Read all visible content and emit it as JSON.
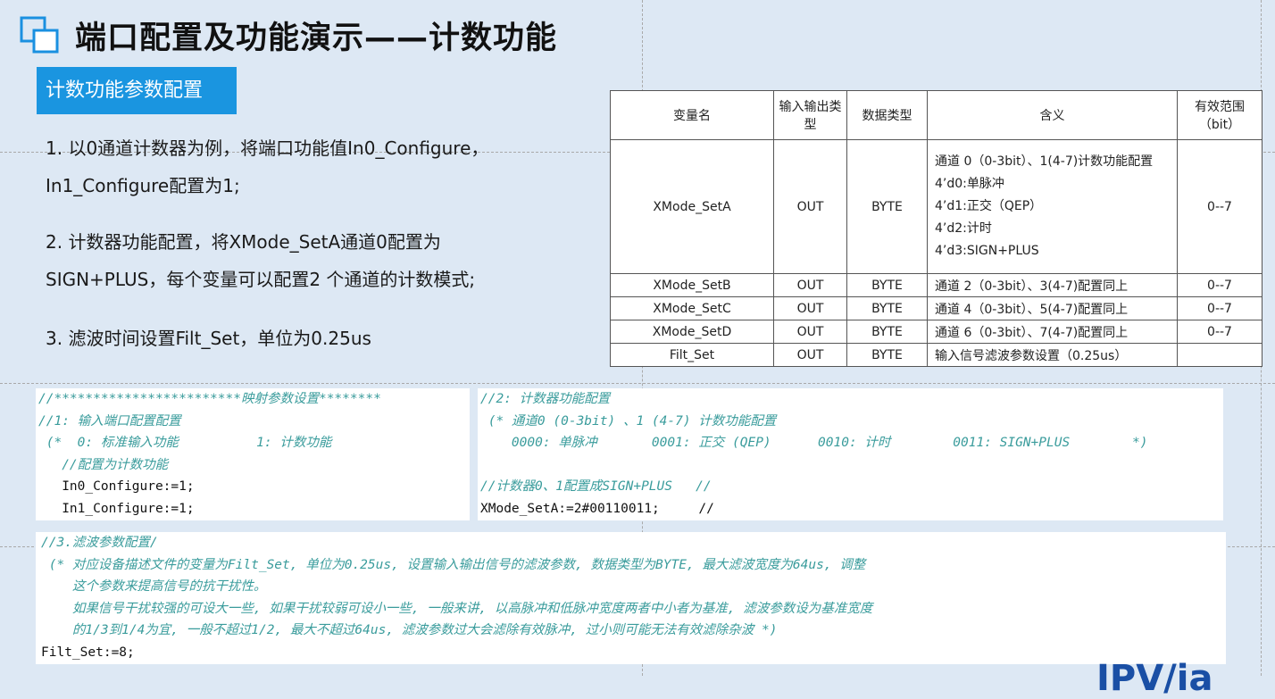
{
  "title": "端口配置及功能演示——计数功能",
  "section_badge": "计数功能参数配置",
  "paragraphs": [
    {
      "line1": "1. 以0通道计数器为例，将端口功能值In0_Configure，",
      "line2": "In1_Configure配置为1;"
    },
    {
      "line1": "2. 计数器功能配置，将XMode_SetA通道0配置为",
      "line2": "SIGN+PLUS，每个变量可以配置2 个通道的计数模式;"
    },
    {
      "line1": "3. 滤波时间设置Filt_Set，单位为0.25us"
    }
  ],
  "table": {
    "headers": [
      "变量名",
      "输入输出类型",
      "数据类型",
      "含义",
      "有效范围（bit）"
    ],
    "rows": [
      {
        "name": "XMode_SetA",
        "io": "OUT",
        "type": "BYTE",
        "meaning": [
          "通道 0（0-3bit）、1(4-7)计数功能配置",
          "4’d0:单脉冲",
          "4’d1:正交（QEP）",
          "4’d2:计时",
          "4’d3:SIGN+PLUS"
        ],
        "range": "0--7"
      },
      {
        "name": "XMode_SetB",
        "io": "OUT",
        "type": "BYTE",
        "meaning": [
          "通道 2（0-3bit）、3(4-7)配置同上"
        ],
        "range": "0--7"
      },
      {
        "name": "XMode_SetC",
        "io": "OUT",
        "type": "BYTE",
        "meaning": [
          "通道 4（0-3bit）、5(4-7)配置同上"
        ],
        "range": "0--7"
      },
      {
        "name": "XMode_SetD",
        "io": "OUT",
        "type": "BYTE",
        "meaning": [
          "通道 6（0-3bit）、7(4-7)配置同上"
        ],
        "range": "0--7"
      },
      {
        "name": "Filt_Set",
        "io": "OUT",
        "type": "BYTE",
        "meaning": [
          "输入信号滤波参数设置（0.25us）"
        ],
        "range": ""
      }
    ]
  },
  "code_left": [
    {
      "kind": "comment",
      "text": "//************************映射参数设置********"
    },
    {
      "kind": "comment",
      "text": "//1: 输入端口配置配置"
    },
    {
      "kind": "comment",
      "text": " (*  0: 标准输入功能          1: 计数功能"
    },
    {
      "kind": "comment",
      "text": "   //配置为计数功能"
    },
    {
      "kind": "code",
      "text": "   In0_Configure:=1;"
    },
    {
      "kind": "code",
      "text": "   In1_Configure:=1;"
    }
  ],
  "code_right": [
    {
      "kind": "comment",
      "text": "//2: 计数器功能配置"
    },
    {
      "kind": "comment",
      "text": " (* 通道0 (0-3bit) 、1 (4-7) 计数功能配置"
    },
    {
      "kind": "comment",
      "text": "    0000: 单脉冲       0001: 正交 (QEP)      0010: 计时        0011: SIGN+PLUS        *)"
    },
    {
      "kind": "comment",
      "text": " "
    },
    {
      "kind": "comment",
      "text": "//计数器0、1配置成SIGN+PLUS   //"
    },
    {
      "kind": "code",
      "text": "XMode_SetA:=2#00110011;     //"
    }
  ],
  "code_bottom": [
    {
      "kind": "comment",
      "text": "//3.滤波参数配置/"
    },
    {
      "kind": "comment",
      "text": " (* 对应设备描述文件的变量为Filt_Set, 单位为0.25us, 设置输入输出信号的滤波参数, 数据类型为BYTE, 最大滤波宽度为64us, 调整"
    },
    {
      "kind": "comment",
      "text": "    这个参数来提高信号的抗干扰性。"
    },
    {
      "kind": "comment",
      "text": "    如果信号干扰较强的可设大一些, 如果干扰较弱可设小一些, 一般来讲, 以高脉冲和低脉冲宽度两者中小者为基准, 滤波参数设为基准宽度"
    },
    {
      "kind": "comment",
      "text": "    的1/3到1/4为宜, 一般不超过1/2, 最大不超过64us, 滤波参数过大会滤除有效脉冲, 过小则可能无法有效滤除杂波 *)"
    },
    {
      "kind": "code",
      "text": "Filt_Set:=8;"
    }
  ],
  "brand": "IPV/ia",
  "colors": {
    "badge": "#1a95e0",
    "comment": "#3a9c9c",
    "background": "#dde8f4",
    "logo": "#1a90e0"
  }
}
